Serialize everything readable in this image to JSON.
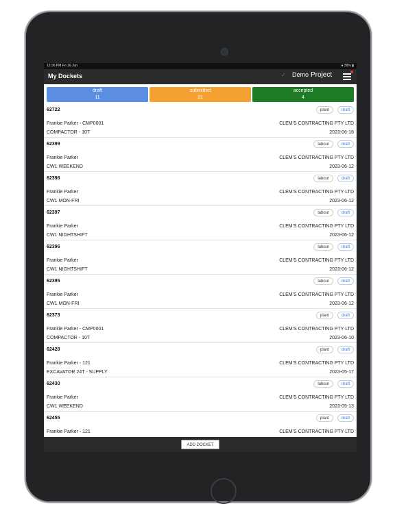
{
  "status_bar": {
    "time_date": "12:36 PM  Fri 16 Jun",
    "battery": "● 38% ▮"
  },
  "header": {
    "title": "My Dockets",
    "project_prefix": "Demo",
    "project_name": "Project",
    "sync_icon": "check-icon",
    "menu_icon": "hamburger-menu-icon",
    "notification_dot_color": "#e53935"
  },
  "tabs": [
    {
      "label": "draft",
      "count": "11",
      "color": "#5b8ee0"
    },
    {
      "label": "submitted",
      "count": "21",
      "color": "#f4a133"
    },
    {
      "label": "accepted",
      "count": "4",
      "color": "#1d7a25"
    }
  ],
  "dockets": [
    {
      "number": "62722",
      "type": "plant",
      "status": "draft",
      "person": "Frankie Parker - CMP0001",
      "company": "CLEM'S CONTRACTING PTY LTD",
      "description": "COMPACTOR - 10T",
      "date": "2023-06-16"
    },
    {
      "number": "62399",
      "type": "labour",
      "status": "draft",
      "person": "Frankie Parker",
      "company": "CLEM'S CONTRACTING PTY LTD",
      "description": "CW1 WEEKEND",
      "date": "2023-06-12"
    },
    {
      "number": "62398",
      "type": "labour",
      "status": "draft",
      "person": "Frankie Parker",
      "company": "CLEM'S CONTRACTING PTY LTD",
      "description": "CW1 MON-FRI",
      "date": "2023-06-12"
    },
    {
      "number": "62397",
      "type": "labour",
      "status": "draft",
      "person": "Frankie Parker",
      "company": "CLEM'S CONTRACTING PTY LTD",
      "description": "CW1 NIGHTSHIFT",
      "date": "2023-06-12"
    },
    {
      "number": "62396",
      "type": "labour",
      "status": "draft",
      "person": "Frankie Parker",
      "company": "CLEM'S CONTRACTING PTY LTD",
      "description": "CW1 NIGHTSHIFT",
      "date": "2023-06-12"
    },
    {
      "number": "62395",
      "type": "labour",
      "status": "draft",
      "person": "Frankie Parker",
      "company": "CLEM'S CONTRACTING PTY LTD",
      "description": "CW1 MON-FRI",
      "date": "2023-06-12"
    },
    {
      "number": "62373",
      "type": "plant",
      "status": "draft",
      "person": "Frankie Parker - CMP0001",
      "company": "CLEM'S CONTRACTING PTY LTD",
      "description": "COMPACTOR - 10T",
      "date": "2023-06-10"
    },
    {
      "number": "62428",
      "type": "plant",
      "status": "draft",
      "person": "Frankie Parker - 121",
      "company": "CLEM'S CONTRACTING PTY LTD",
      "description": "EXCAVATOR 24T - SUPPLY",
      "date": "2023-05-17"
    },
    {
      "number": "62430",
      "type": "labour",
      "status": "draft",
      "person": "Frankie Parker",
      "company": "CLEM'S CONTRACTING PTY LTD",
      "description": "CW1 WEEKEND",
      "date": "2023-05-13"
    },
    {
      "number": "62455",
      "type": "plant",
      "status": "draft",
      "person": "Frankie Parker - 121",
      "company": "CLEM'S CONTRACTING PTY LTD",
      "description": "",
      "date": ""
    }
  ],
  "footer": {
    "add_label": "ADD DOCKET"
  }
}
